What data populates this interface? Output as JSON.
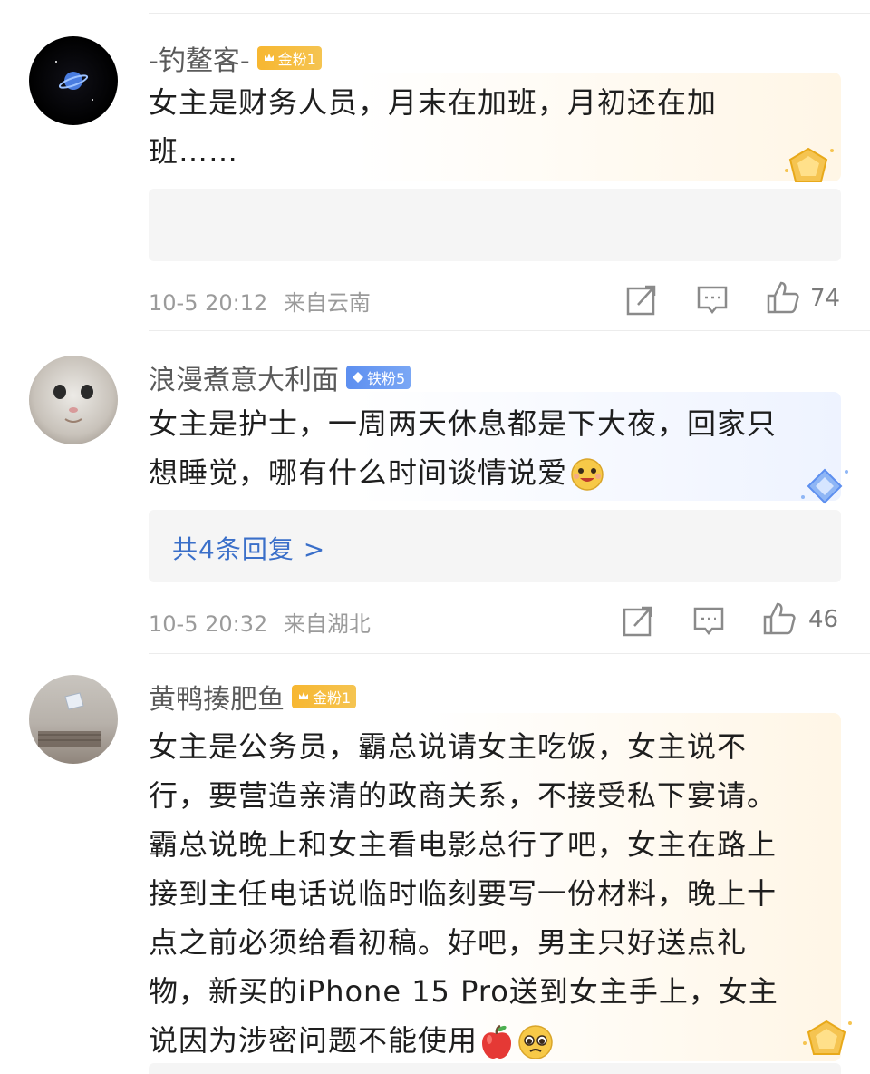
{
  "comments": [
    {
      "username": "-钓鳌客-",
      "badge": "金粉1",
      "lines": [
        "女主是财务人员，月末在加班，月初还在加",
        "班……"
      ],
      "time": "10-5 20:12",
      "location": "来自云南",
      "likes": "74"
    },
    {
      "username": "浪漫煮意大利面",
      "badge": "铁粉5",
      "lines": [
        "女主是护士，一周两天休息都是下大夜，回家只",
        "想睡觉，哪有什么时间谈情说爱"
      ],
      "reply_text": "共4条回复 >",
      "time": "10-5 20:32",
      "location": "来自湖北",
      "likes": "46"
    },
    {
      "username": "黄鸭揍肥鱼",
      "badge": "金粉1",
      "lines": [
        "女主是公务员，霸总说请女主吃饭，女主说不",
        "行，要营造亲清的政商关系，不接受私下宴请。",
        "霸总说晚上和女主看电影总行了吧，女主在路上",
        "接到主任电话说临时临刻要写一份材料，晚上十",
        "点之前必须给看初稿。好吧，男主只好送点礼",
        "物，新买的iPhone 15 Pro送到女主手上，女主",
        "说因为涉密问题不能使用"
      ]
    }
  ],
  "colors": {
    "gold_badge": "#f7b731",
    "iron_badge": "#5d8ff0",
    "reply_link": "#3a6fc9",
    "meta_text": "#9b9b9b"
  },
  "icons": {
    "share": "share-icon",
    "comment": "comment-icon",
    "like": "thumbs-up-icon"
  }
}
